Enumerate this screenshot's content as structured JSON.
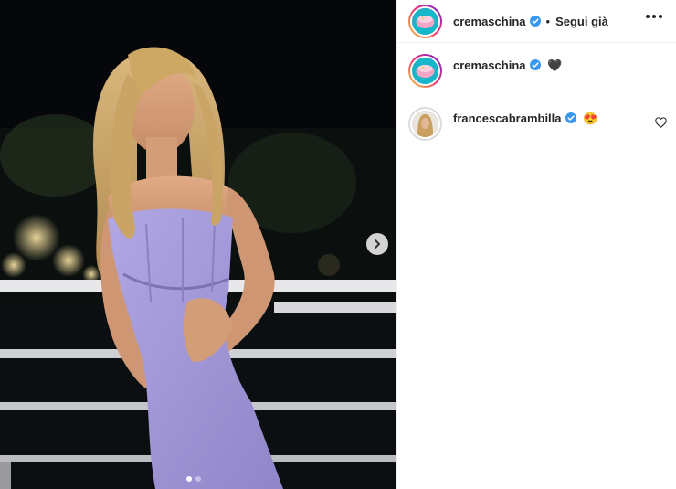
{
  "post": {
    "author": "cremaschina",
    "follow_separator": "•",
    "follow_label": "Segui già",
    "carousel": {
      "total_images": 2,
      "current_index": 1
    }
  },
  "comments": [
    {
      "username": "cremaschina",
      "text": "🖤"
    },
    {
      "username": "francescabrambilla",
      "text": "😍"
    }
  ],
  "icons": {
    "verified": "verified-badge-icon",
    "more": "more-options-icon",
    "next": "chevron-right-icon",
    "like": "heart-icon"
  },
  "colors": {
    "verified_blue": "#3897f0",
    "story_ring_start": "#f9ce34",
    "story_ring_end": "#6228d7",
    "dress": "#a59ad9"
  }
}
